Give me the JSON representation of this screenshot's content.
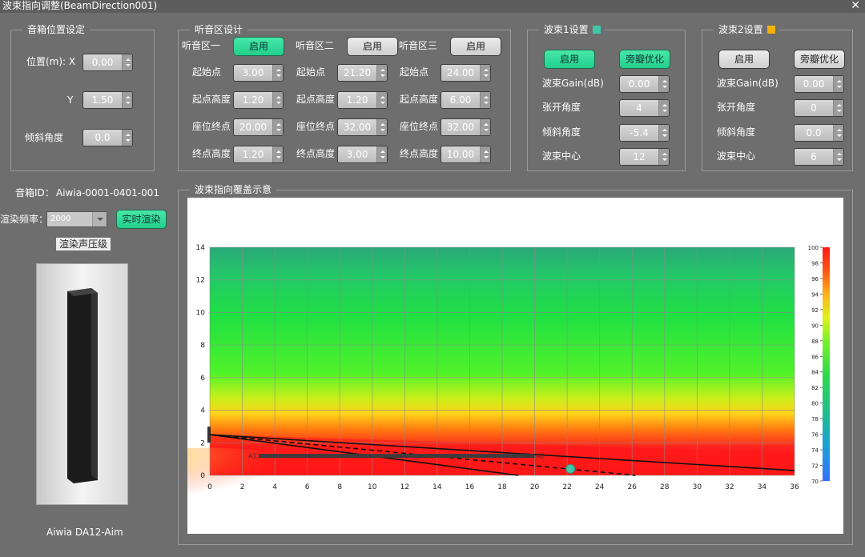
{
  "window": {
    "title": "波束指向调整(BeamDirection001)",
    "close": "✕"
  },
  "speaker_pos": {
    "caption": "音箱位置设定",
    "x_label": "位置(m):  X",
    "x_value": "0.00",
    "y_label": "Y",
    "y_value": "1.50",
    "tilt_label": "倾斜角度",
    "tilt_value": "0.0"
  },
  "speaker_info": {
    "id_label": "音箱ID：",
    "id_value": "Aiwia-0001-0401-001",
    "freq_label": "渲染频率：",
    "freq_value": "2000",
    "realtime_btn": "实时渲染",
    "spl_tag": "渲染声压级",
    "model": "Aiwia DA12-Aim"
  },
  "zones": {
    "caption": "听音区设计",
    "enable": "启用",
    "row_labels": [
      "起始点",
      "起点高度",
      "座位终点",
      "终点高度"
    ],
    "items": [
      {
        "name": "听音区一",
        "active": true,
        "values": [
          "3.00",
          "1.20",
          "20.00",
          "1.20"
        ]
      },
      {
        "name": "听音区二",
        "active": false,
        "values": [
          "21.20",
          "1.20",
          "32.00",
          "3.00"
        ]
      },
      {
        "name": "听音区三",
        "active": false,
        "values": [
          "24.00",
          "6.00",
          "32.00",
          "10.00"
        ]
      }
    ]
  },
  "beams": [
    {
      "caption": "波束1设置",
      "color": "#3fc7a8",
      "enable": "启用",
      "enable_active": true,
      "opt": "旁瓣优化",
      "opt_active": true,
      "labels": [
        "波束Gain(dB)",
        "张开角度",
        "倾斜角度",
        "波束中心"
      ],
      "values": [
        "0.00",
        "4",
        "-5.4",
        "12"
      ]
    },
    {
      "caption": "波束2设置",
      "color": "#f2b100",
      "enable": "启用",
      "enable_active": false,
      "opt": "旁瓣优化",
      "opt_active": false,
      "labels": [
        "波束Gain(dB)",
        "张开角度",
        "倾斜角度",
        "波束中心"
      ],
      "values": [
        "0.00",
        "0",
        "0.0",
        "6"
      ]
    }
  ],
  "coverage": {
    "caption": "波束指向覆盖示意"
  },
  "chart_data": {
    "type": "heatmap",
    "title": "",
    "xlabel": "",
    "ylabel": "",
    "xlim": [
      0,
      36
    ],
    "ylim": [
      0,
      14
    ],
    "xticks": [
      0,
      2,
      4,
      6,
      8,
      10,
      12,
      14,
      16,
      18,
      20,
      22,
      24,
      26,
      28,
      30,
      32,
      34,
      36
    ],
    "yticks": [
      0,
      2,
      4,
      6,
      8,
      10,
      12,
      14
    ],
    "grid": true,
    "colorbar": {
      "min": 70,
      "max": 100,
      "ticks": [
        70,
        72,
        74,
        76,
        78,
        80,
        82,
        84,
        86,
        88,
        90,
        92,
        94,
        96,
        98,
        100
      ]
    },
    "speaker_height": 2.5,
    "zone_line": {
      "x": [
        3,
        20
      ],
      "y": [
        1.2,
        1.2
      ],
      "labels": [
        "A1",
        "A2"
      ]
    },
    "beam_lines": [
      {
        "style": "solid",
        "x": [
          0,
          36
        ],
        "y": [
          2.5,
          0.3
        ]
      },
      {
        "style": "dashed",
        "x": [
          0,
          26.2
        ],
        "y": [
          2.5,
          0
        ]
      },
      {
        "style": "solid",
        "x": [
          0,
          19
        ],
        "y": [
          2.5,
          0
        ]
      }
    ],
    "beam_center": {
      "x": 22.2,
      "y": 0.4
    }
  }
}
